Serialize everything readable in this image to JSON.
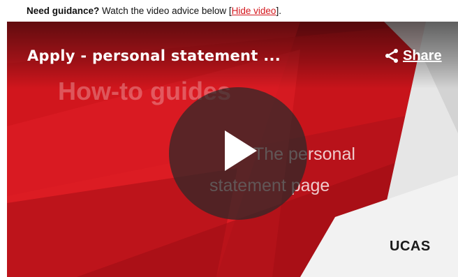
{
  "guidance": {
    "lead": "Need guidance?",
    "text": " Watch the video advice below [",
    "hide_link": "Hide video",
    "tail": "]."
  },
  "video": {
    "title": "Apply - personal statement ...",
    "share_label": "Share",
    "slide_heading": "How-to guides",
    "slide_line1": "The personal",
    "slide_line2": "statement page",
    "logo": "UCAS",
    "icons": {
      "share": "share-icon",
      "play": "play-icon"
    }
  },
  "colors": {
    "brand_red": "#c4141b",
    "link_red": "#d4161c"
  }
}
